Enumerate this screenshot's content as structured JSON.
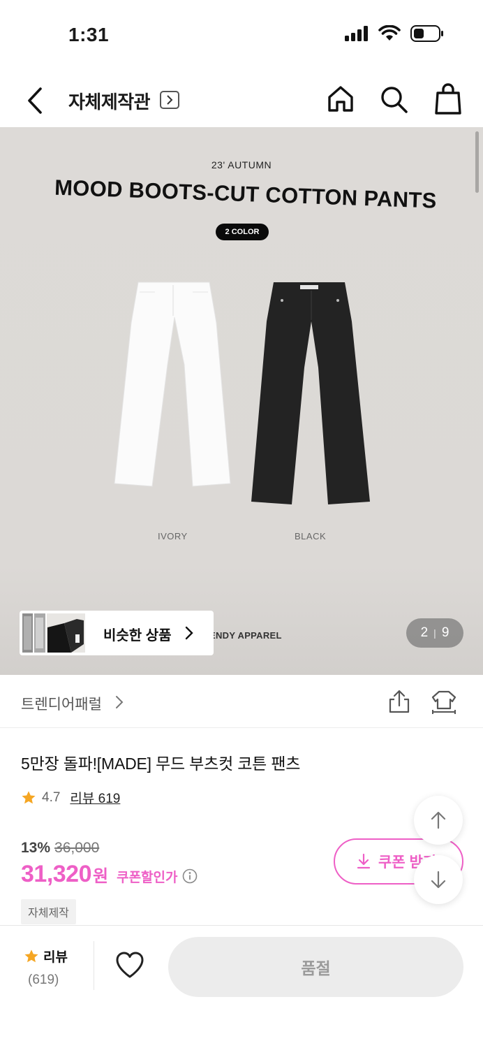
{
  "status_bar": {
    "time": "1:31",
    "icons": [
      "signal-icon",
      "wifi-icon",
      "battery-icon"
    ]
  },
  "nav": {
    "title": "자체제작관",
    "icons": [
      "back-icon",
      "chevron-right-icon",
      "home-icon",
      "search-icon",
      "shopping-bag-icon"
    ]
  },
  "hero": {
    "season": "23' AUTUMN",
    "title": "MOOD BOOTS-CUT COTTON PANTS",
    "color_count": "2 COLOR",
    "colors": [
      "IVORY",
      "BLACK"
    ],
    "brand_text": "ENDY APPAREL",
    "similar_label": "비슷한 상품",
    "page_current": "2",
    "page_separator": "|",
    "page_total": "9"
  },
  "brand": {
    "name": "트렌디어패럴",
    "icons": [
      "share-icon",
      "size-fit-icon"
    ]
  },
  "product": {
    "name": "5만장 돌파![MADE] 무드 부츠컷 코튼 팬츠",
    "rating": "4.7",
    "review_link": "리뷰 619",
    "discount_rate": "13%",
    "original_price": "36,000",
    "price": "31,320",
    "price_unit": "원",
    "coupon_price_label": "쿠폰할인가",
    "tag": "자체제작",
    "coupon_button": "쿠폰 받기"
  },
  "bottom_bar": {
    "review_label": "리뷰",
    "review_count": "(619)",
    "soldout_label": "품절"
  },
  "colors": {
    "accent": "#ee5fc6",
    "star": "#f5a623",
    "hero_bg": "#dddad7"
  }
}
